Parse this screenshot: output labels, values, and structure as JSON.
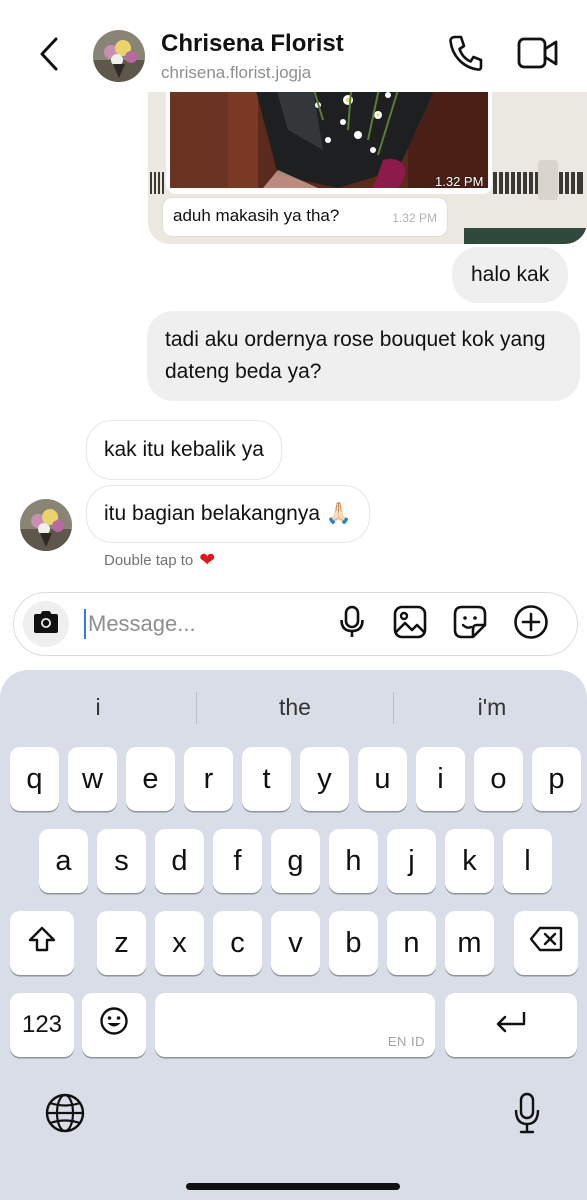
{
  "header": {
    "name": "Chrisena Florist",
    "handle": "chrisena.florist.jogja",
    "back_icon": "chevron-left-icon",
    "call_icon": "phone-icon",
    "video_icon": "video-camera-icon"
  },
  "shared_photo": {
    "time": "1.32 PM",
    "reply_text": "aduh makasih ya tha?",
    "reply_time": "1.32 PM"
  },
  "messages": [
    {
      "direction": "outgoing",
      "text": "halo kak"
    },
    {
      "direction": "outgoing",
      "text": "tadi aku ordernya rose bouquet kok yang dateng beda ya?"
    },
    {
      "direction": "incoming",
      "text": "kak itu kebalik ya"
    },
    {
      "direction": "incoming",
      "text": "itu bagian belakangnya 🙏🏻"
    }
  ],
  "reaction_hint": {
    "text": "Double tap to",
    "icon": "heart-icon"
  },
  "composer": {
    "placeholder": "Message...",
    "value": "",
    "icons": [
      "camera-icon",
      "microphone-icon",
      "gallery-icon",
      "sticker-icon",
      "plus-circle-icon"
    ]
  },
  "keyboard": {
    "suggestions": [
      "i",
      "the",
      "i'm"
    ],
    "rows": [
      [
        "q",
        "w",
        "e",
        "r",
        "t",
        "y",
        "u",
        "i",
        "o",
        "p"
      ],
      [
        "a",
        "s",
        "d",
        "f",
        "g",
        "h",
        "j",
        "k",
        "l"
      ],
      [
        "z",
        "x",
        "c",
        "v",
        "b",
        "n",
        "m"
      ]
    ],
    "numbers_label": "123",
    "language_tag": "EN ID",
    "shift_icon": "shift-icon",
    "backspace_icon": "backspace-icon",
    "emoji_icon": "emoji-icon",
    "return_icon": "return-icon",
    "globe_icon": "globe-icon",
    "dictation_icon": "microphone-icon"
  },
  "colors": {
    "outgoing_bubble": "#efefef",
    "keyboard_bg": "#d8dde8",
    "caret": "#3478f6",
    "heart": "#e0181f"
  }
}
